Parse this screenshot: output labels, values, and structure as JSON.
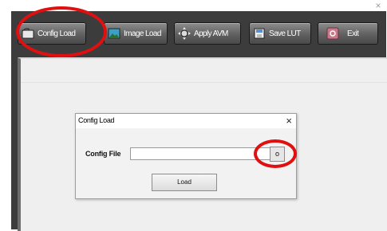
{
  "window": {
    "close_glyph": "×"
  },
  "toolbar": {
    "buttons": [
      {
        "label": "Config Load",
        "icon": "folder-icon"
      },
      {
        "label": "Image Load",
        "icon": "image-icon"
      },
      {
        "label": "Apply AVM",
        "icon": "gear-arrows-icon"
      },
      {
        "label": "Save LUT",
        "icon": "floppy-disk-icon"
      },
      {
        "label": "Exit",
        "icon": "exit-icon"
      }
    ]
  },
  "dialog": {
    "title": "Config Load",
    "close_glyph": "×",
    "field_label": "Config File",
    "field_value": "",
    "browse_label": "o",
    "load_label": "Load"
  },
  "colors": {
    "annotation": "#e01010",
    "toolbar_bg": "#3c3c3c",
    "button_gradient_top": "#8d8d8d"
  }
}
